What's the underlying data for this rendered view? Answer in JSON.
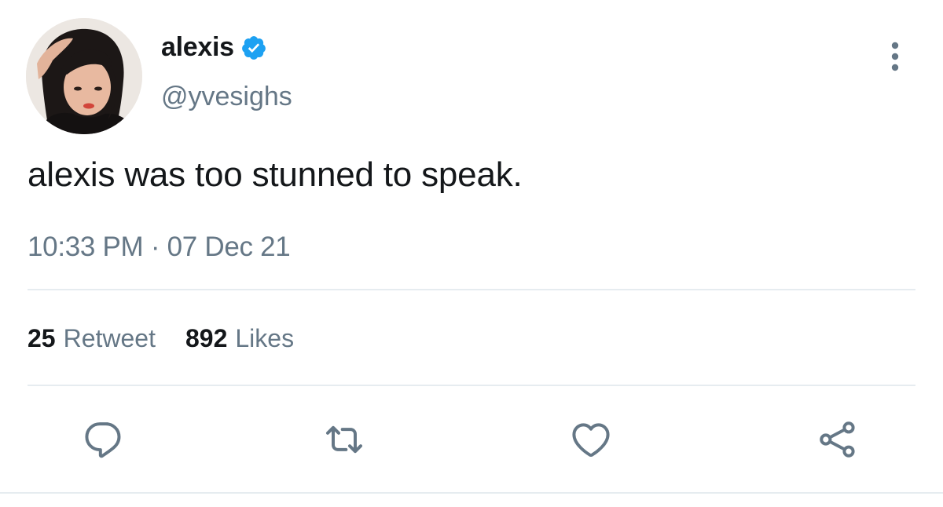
{
  "user": {
    "display_name": "alexis",
    "handle": "@yvesighs",
    "verified": true
  },
  "tweet": {
    "text": "alexis was too stunned to speak.",
    "timestamp": "10:33 PM · 07 Dec 21"
  },
  "stats": {
    "retweets_count": "25",
    "retweets_label": "Retweet",
    "likes_count": "892",
    "likes_label": "Likes"
  },
  "icons": {
    "verified": "verified-badge-icon",
    "more": "more-vertical-icon",
    "reply": "reply-icon",
    "retweet": "retweet-icon",
    "like": "heart-icon",
    "share": "share-icon"
  },
  "colors": {
    "primary_text": "#14171a",
    "secondary_text": "#657786",
    "icon_gray": "#657786",
    "verified_blue": "#1da1f2",
    "divider": "#e6ecf0"
  }
}
